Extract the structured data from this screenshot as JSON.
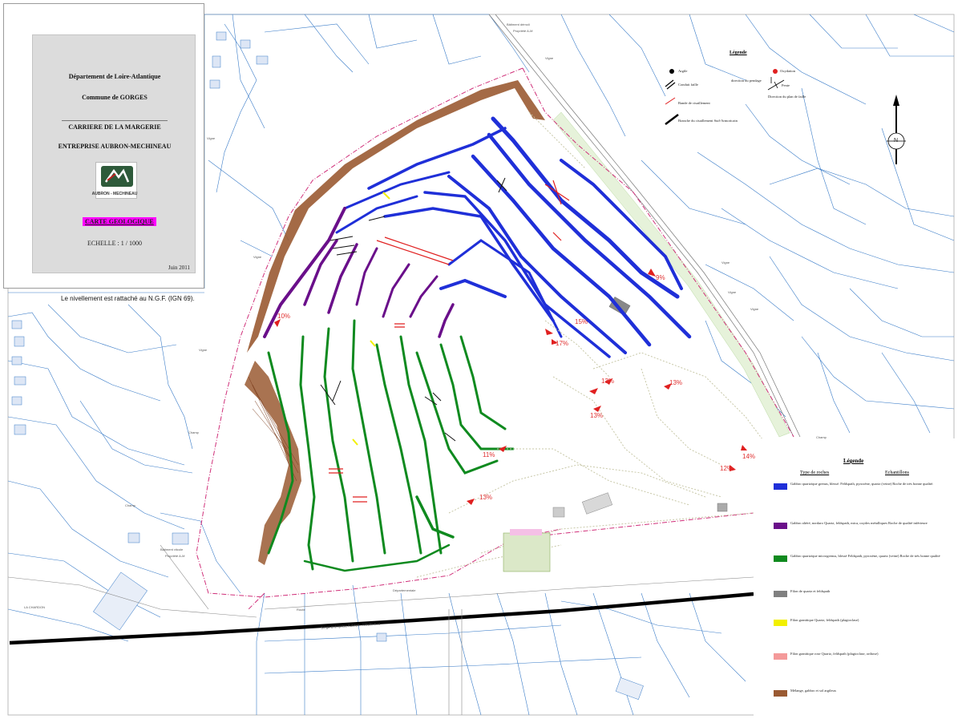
{
  "cartouche": {
    "department": "Département de Loire-Atlantique",
    "commune": "Commune de GORGES",
    "quarry": "CARRIERE DE LA MARGERIE",
    "company": "ENTREPRISE AUBRON-MECHINEAU",
    "logo_text": "AUBRON - MECHINEAU",
    "map_title": "CARTE GEOLOGIQUE",
    "scale": "ECHELLE : 1 / 1000",
    "date": "Juin 2011"
  },
  "nivellement_note": "Le nivellement est rattaché au N.G.F. (IGN 69).",
  "top_legend": {
    "title": "Légende",
    "items": {
      "argile": "Argile",
      "conduit_faille": "Conduit faille",
      "bande_cisaillement": "Bande de cisaillement",
      "branche_cisaillement": "Branche du cisaillement Sud-Armoricain",
      "oxydation": "Oxydation",
      "direction_pendage": "direction du pendage",
      "pente": "Pente",
      "direction_plan_faille": "Direction du plan de faille"
    }
  },
  "north_label": "N",
  "legend": {
    "title": "Légende",
    "col_rocks": "Type de roches",
    "col_samples": "Echantillons",
    "items": [
      {
        "color": "#1f2fd8",
        "text": "Gabbro quartzique grenus, blessé. Feldspath, pyroxène, quartz (veine) Roche de très bonne qualité."
      },
      {
        "color": "#6a0f8a",
        "text": "Gabbro altéré, nordaro Quartz, feldspath, mica, oxydes métalliques Roche de qualité inférieure"
      },
      {
        "color": "#0f8a1f",
        "text": "Gabbro quartzique microgrenus, blessé Feldspath, pyroxène, quartz (veine) Roche de très bonne qualité"
      },
      {
        "color": "#808080",
        "text": "Filon de quartz et feldspath"
      },
      {
        "color": "#f2f000",
        "text": "Filon granitique Quartz, feldspath (plagioclase)"
      },
      {
        "color": "#f49a9a",
        "text": "Filon granitique rose Quartz, feldspath (plagioclase, orthose)"
      },
      {
        "color": "#9a5a32",
        "text": "Mélange, gabbro et sol argileux"
      }
    ]
  },
  "slopes": [
    "9%",
    "10%",
    "15%",
    "17%",
    "13%",
    "13%",
    "13%",
    "11%",
    "13%",
    "12%",
    "14%"
  ],
  "map_labels": {
    "batiment_demoli": "Bâtiment démoli",
    "propriete_am": "Propriété A-M",
    "batiment_vitcole": "Bâtiment vitcole",
    "propriete_am2": "Propriété A-M",
    "siege": "Siège entreprise Aubron - Méchineau",
    "vigne": "Vigne",
    "champ": "Champ",
    "la_chardon": "LA CHARDON",
    "departementale": "Départementale",
    "route": "Route"
  },
  "colors": {
    "blue": "#1f2fd8",
    "purple": "#6a0f8a",
    "green": "#0f8a1f",
    "brown": "#9a5a32",
    "cadastre": "#3a7cc8",
    "boundary": "#d0307a",
    "track": "#d8d8c0",
    "slope_arrow": "#e02020"
  }
}
